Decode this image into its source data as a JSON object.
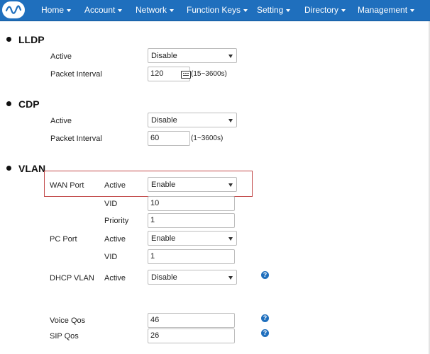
{
  "nav": {
    "items": [
      "Home",
      "Account",
      "Network",
      "Function Keys",
      "Setting",
      "Directory",
      "Management"
    ]
  },
  "lldp": {
    "title": "LLDP",
    "active_label": "Active",
    "active_value": "Disable",
    "interval_label": "Packet Interval",
    "interval_value": "120",
    "interval_hint": "(15~3600s)"
  },
  "cdp": {
    "title": "CDP",
    "active_label": "Active",
    "active_value": "Disable",
    "interval_label": "Packet Interval",
    "interval_value": "60",
    "interval_hint": "(1~3600s)"
  },
  "vlan": {
    "title": "VLAN",
    "wan": {
      "label": "WAN Port",
      "active_label": "Active",
      "active_value": "Enable",
      "vid_label": "VID",
      "vid_value": "10",
      "priority_label": "Priority",
      "priority_value": "1"
    },
    "pc": {
      "label": "PC Port",
      "active_label": "Active",
      "active_value": "Enable",
      "vid_label": "VID",
      "vid_value": "1"
    },
    "dhcp": {
      "label": "DHCP VLAN",
      "active_label": "Active",
      "active_value": "Disable"
    }
  },
  "qos": {
    "voice_label": "Voice Qos",
    "voice_value": "46",
    "sip_label": "SIP Qos",
    "sip_value": "26"
  },
  "help_glyph": "?",
  "colors": {
    "navbar": "#1f6fbd",
    "highlight_border": "#c24a4a"
  }
}
